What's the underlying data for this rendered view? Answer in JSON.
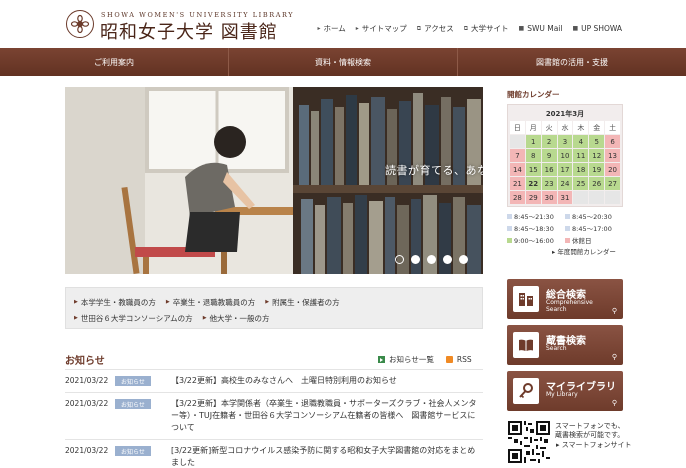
{
  "header": {
    "logo_en": "SHOWA WOMEN'S UNIVERSITY LIBRARY",
    "logo_ja": "昭和女子大学 図書館",
    "links": [
      {
        "label": "ホーム",
        "icon": "arrow-icon"
      },
      {
        "label": "サイトマップ",
        "icon": "arrow-icon"
      },
      {
        "label": "アクセス",
        "icon": "link-icon"
      },
      {
        "label": "大学サイト",
        "icon": "link-icon"
      },
      {
        "label": "SWU Mail",
        "icon": "lock-icon"
      },
      {
        "label": "UP SHOWA",
        "icon": "lock-icon"
      }
    ]
  },
  "nav": {
    "items": [
      "ご利用案内",
      "資料・情報検索",
      "図書館の活用・支援"
    ]
  },
  "hero": {
    "caption": "読書が育てる、あなたの未来。",
    "slides_total": 5,
    "active_slide": 1
  },
  "quick_links": {
    "row1": [
      "本学学生・教職員の方",
      "卒業生・退職教職員の方",
      "附属生・保護者の方"
    ],
    "row2": [
      "世田谷６大学コンソーシアムの方",
      "他大学・一般の方"
    ]
  },
  "news": {
    "title": "お知らせ",
    "list_link": "お知らせ一覧",
    "rss": "RSS",
    "items": [
      {
        "date": "2021/03/22",
        "badge": "お知らせ",
        "text": "【3/22更新】高校生のみなさんへ　土曜日特別利用のお知らせ"
      },
      {
        "date": "2021/03/22",
        "badge": "お知らせ",
        "text": "【3/22更新】本学関係者（卒業生・退職教職員・サポーターズクラブ・社会人メンター等）・TUJ在籍者・世田谷６大学コンソーシアム在籍者の皆様へ　図書館サービスについて"
      },
      {
        "date": "2021/03/22",
        "badge": "お知らせ",
        "text": "[3/22更新]新型コロナウイルス感染予防に関する昭和女子大学図書館の対応をまとめました"
      }
    ]
  },
  "calendar": {
    "title": "開館カレンダー",
    "month": "2021年3月",
    "weekdays": [
      "日",
      "月",
      "火",
      "水",
      "木",
      "金",
      "土"
    ],
    "cells": [
      {
        "d": "",
        "c": "gray"
      },
      {
        "d": "1",
        "c": "green"
      },
      {
        "d": "2",
        "c": "green"
      },
      {
        "d": "3",
        "c": "green"
      },
      {
        "d": "4",
        "c": "green"
      },
      {
        "d": "5",
        "c": "green"
      },
      {
        "d": "6",
        "c": "pink"
      },
      {
        "d": "7",
        "c": "pink"
      },
      {
        "d": "8",
        "c": "green"
      },
      {
        "d": "9",
        "c": "green"
      },
      {
        "d": "10",
        "c": "green"
      },
      {
        "d": "11",
        "c": "green"
      },
      {
        "d": "12",
        "c": "green"
      },
      {
        "d": "13",
        "c": "pink"
      },
      {
        "d": "14",
        "c": "pink"
      },
      {
        "d": "15",
        "c": "green"
      },
      {
        "d": "16",
        "c": "green"
      },
      {
        "d": "17",
        "c": "green"
      },
      {
        "d": "18",
        "c": "green"
      },
      {
        "d": "19",
        "c": "green"
      },
      {
        "d": "20",
        "c": "pink"
      },
      {
        "d": "21",
        "c": "pink"
      },
      {
        "d": "22",
        "c": "today"
      },
      {
        "d": "23",
        "c": "green"
      },
      {
        "d": "24",
        "c": "green"
      },
      {
        "d": "25",
        "c": "green"
      },
      {
        "d": "26",
        "c": "green"
      },
      {
        "d": "27",
        "c": "green"
      },
      {
        "d": "28",
        "c": "pink"
      },
      {
        "d": "29",
        "c": "pink"
      },
      {
        "d": "30",
        "c": "pink"
      },
      {
        "d": "31",
        "c": "pink"
      },
      {
        "d": "",
        "c": "gray"
      },
      {
        "d": "",
        "c": "gray"
      },
      {
        "d": "",
        "c": "gray"
      }
    ],
    "legend": [
      {
        "label": "8:45〜21:30",
        "color": "#cdd8ea"
      },
      {
        "label": "8:45〜20:30",
        "color": "#cdd8ea"
      },
      {
        "label": "8:45〜18:30",
        "color": "#cdd8ea"
      },
      {
        "label": "8:45〜17:00",
        "color": "#cdd8ea"
      },
      {
        "label": "9:00〜16:00",
        "color": "#b8d98f"
      },
      {
        "label": "休館日",
        "color": "#f3b6b6"
      }
    ],
    "year_link": "年度開館カレンダー"
  },
  "side_buttons": [
    {
      "title": "総合検索",
      "sub1": "Comprehensive",
      "sub2": "Search",
      "icon": "building-icon"
    },
    {
      "title": "蔵書検索",
      "sub1": "Search",
      "sub2": "",
      "icon": "book-icon"
    },
    {
      "title": "マイライブラリ",
      "sub1": "My Library",
      "sub2": "",
      "icon": "key-icon"
    }
  ],
  "smartphone": {
    "text1": "スマートフォンでも、",
    "text2": "蔵書検索が可能です。",
    "link": "スマートフォンサイト"
  }
}
